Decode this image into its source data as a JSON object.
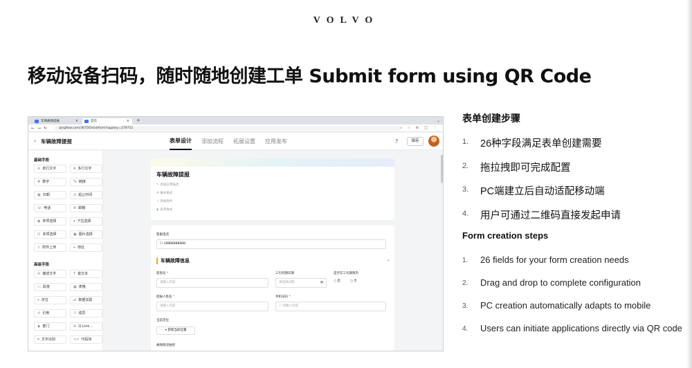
{
  "brand": {
    "logo": "VOLVO"
  },
  "slide_title": "移动设备扫码，随时随地创建工单 Submit form using QR Code",
  "browser": {
    "tabs": [
      {
        "label": "车辆故障提报"
      },
      {
        "label": "首页"
      }
    ],
    "url": "qingflow.com/3675f2e5d/form?appkey=279751"
  },
  "app": {
    "name": "车辆故障提报",
    "tabs": [
      {
        "label": "表单设计"
      },
      {
        "label": "添加流程"
      },
      {
        "label": "拓展设置"
      },
      {
        "label": "应用发布"
      }
    ],
    "save_label": "保存",
    "help_label": "?"
  },
  "sidebar": {
    "basic_title": "基础字段",
    "basic_fields": [
      {
        "icon": "≡",
        "label": "单行文字"
      },
      {
        "icon": "A",
        "label": "多行文字"
      },
      {
        "icon": "#",
        "label": "数字"
      },
      {
        "icon": "%",
        "label": "链接"
      },
      {
        "icon": "▦",
        "label": "日期"
      },
      {
        "icon": "◷",
        "label": "起止时间"
      },
      {
        "icon": "☏",
        "label": "电话"
      },
      {
        "icon": "✉",
        "label": "邮箱"
      },
      {
        "icon": "◉",
        "label": "单项选择"
      },
      {
        "icon": "▾",
        "label": "下拉选择"
      },
      {
        "icon": "☑",
        "label": "多项选择"
      },
      {
        "icon": "▣",
        "label": "图片选择"
      },
      {
        "icon": "⇧",
        "label": "附件上传"
      },
      {
        "icon": "⌖",
        "label": "地址"
      }
    ],
    "advanced_title": "高级字段",
    "advanced_fields": [
      {
        "icon": "≡",
        "label": "描述文字"
      },
      {
        "icon": "T",
        "label": "富文本"
      },
      {
        "icon": "▭",
        "label": "段落"
      },
      {
        "icon": "▦",
        "label": "表格"
      },
      {
        "icon": "⌖",
        "label": "定位"
      },
      {
        "icon": "⇄",
        "label": "数据关联"
      },
      {
        "icon": "↺",
        "label": "引用"
      },
      {
        "icon": "⚇",
        "label": "成员"
      },
      {
        "icon": "♟",
        "label": "部门"
      },
      {
        "icon": "⊘",
        "label": "Q-Link..."
      },
      {
        "icon": "⌗",
        "label": "文字识别"
      },
      {
        "icon": "<>",
        "label": "代码块"
      }
    ]
  },
  "form": {
    "title": "车辆故障提报",
    "meta": [
      "添加应用描述",
      "编号格式",
      "添加附件",
      "表单样式"
    ],
    "phone_label": "客服电话",
    "phone_value": "18888888888",
    "section_title": "车辆故障信息",
    "vin_label": "底盘号",
    "vin_placeholder": "请输入内容",
    "date_label": "三包到期日期",
    "date_placeholder": "请选择日期",
    "warranty_label": "是否在三包期限内",
    "warranty_options": [
      "是",
      "否"
    ],
    "reporter_label": "提报人姓名",
    "reporter_placeholder": "请输入内容",
    "mobile_label": "手机号码",
    "mobile_placeholder": "请输入内容",
    "location_label": "当前定位",
    "location_button": "获取当前位置",
    "photo_label": "故障情况拍照"
  },
  "steps_cn": {
    "heading": "表单创建步骤",
    "items": [
      {
        "num": "1.",
        "text": "26种字段满足表单创建需要"
      },
      {
        "num": "2.",
        "text": "拖拉拽即可完成配置"
      },
      {
        "num": "3.",
        "text": "PC端建立后自动适配移动端"
      },
      {
        "num": "4.",
        "text": "用户可通过二维码直接发起申请"
      }
    ]
  },
  "steps_en": {
    "heading": "Form creation steps",
    "items": [
      {
        "num": "1.",
        "text": "26 fields for your form creation needs"
      },
      {
        "num": "2.",
        "text": "Drag and drop to complete configuration"
      },
      {
        "num": "3.",
        "text": "PC creation automatically adapts to mobile"
      },
      {
        "num": "4.",
        "text": "Users can initiate applications directly via QR code"
      }
    ]
  }
}
